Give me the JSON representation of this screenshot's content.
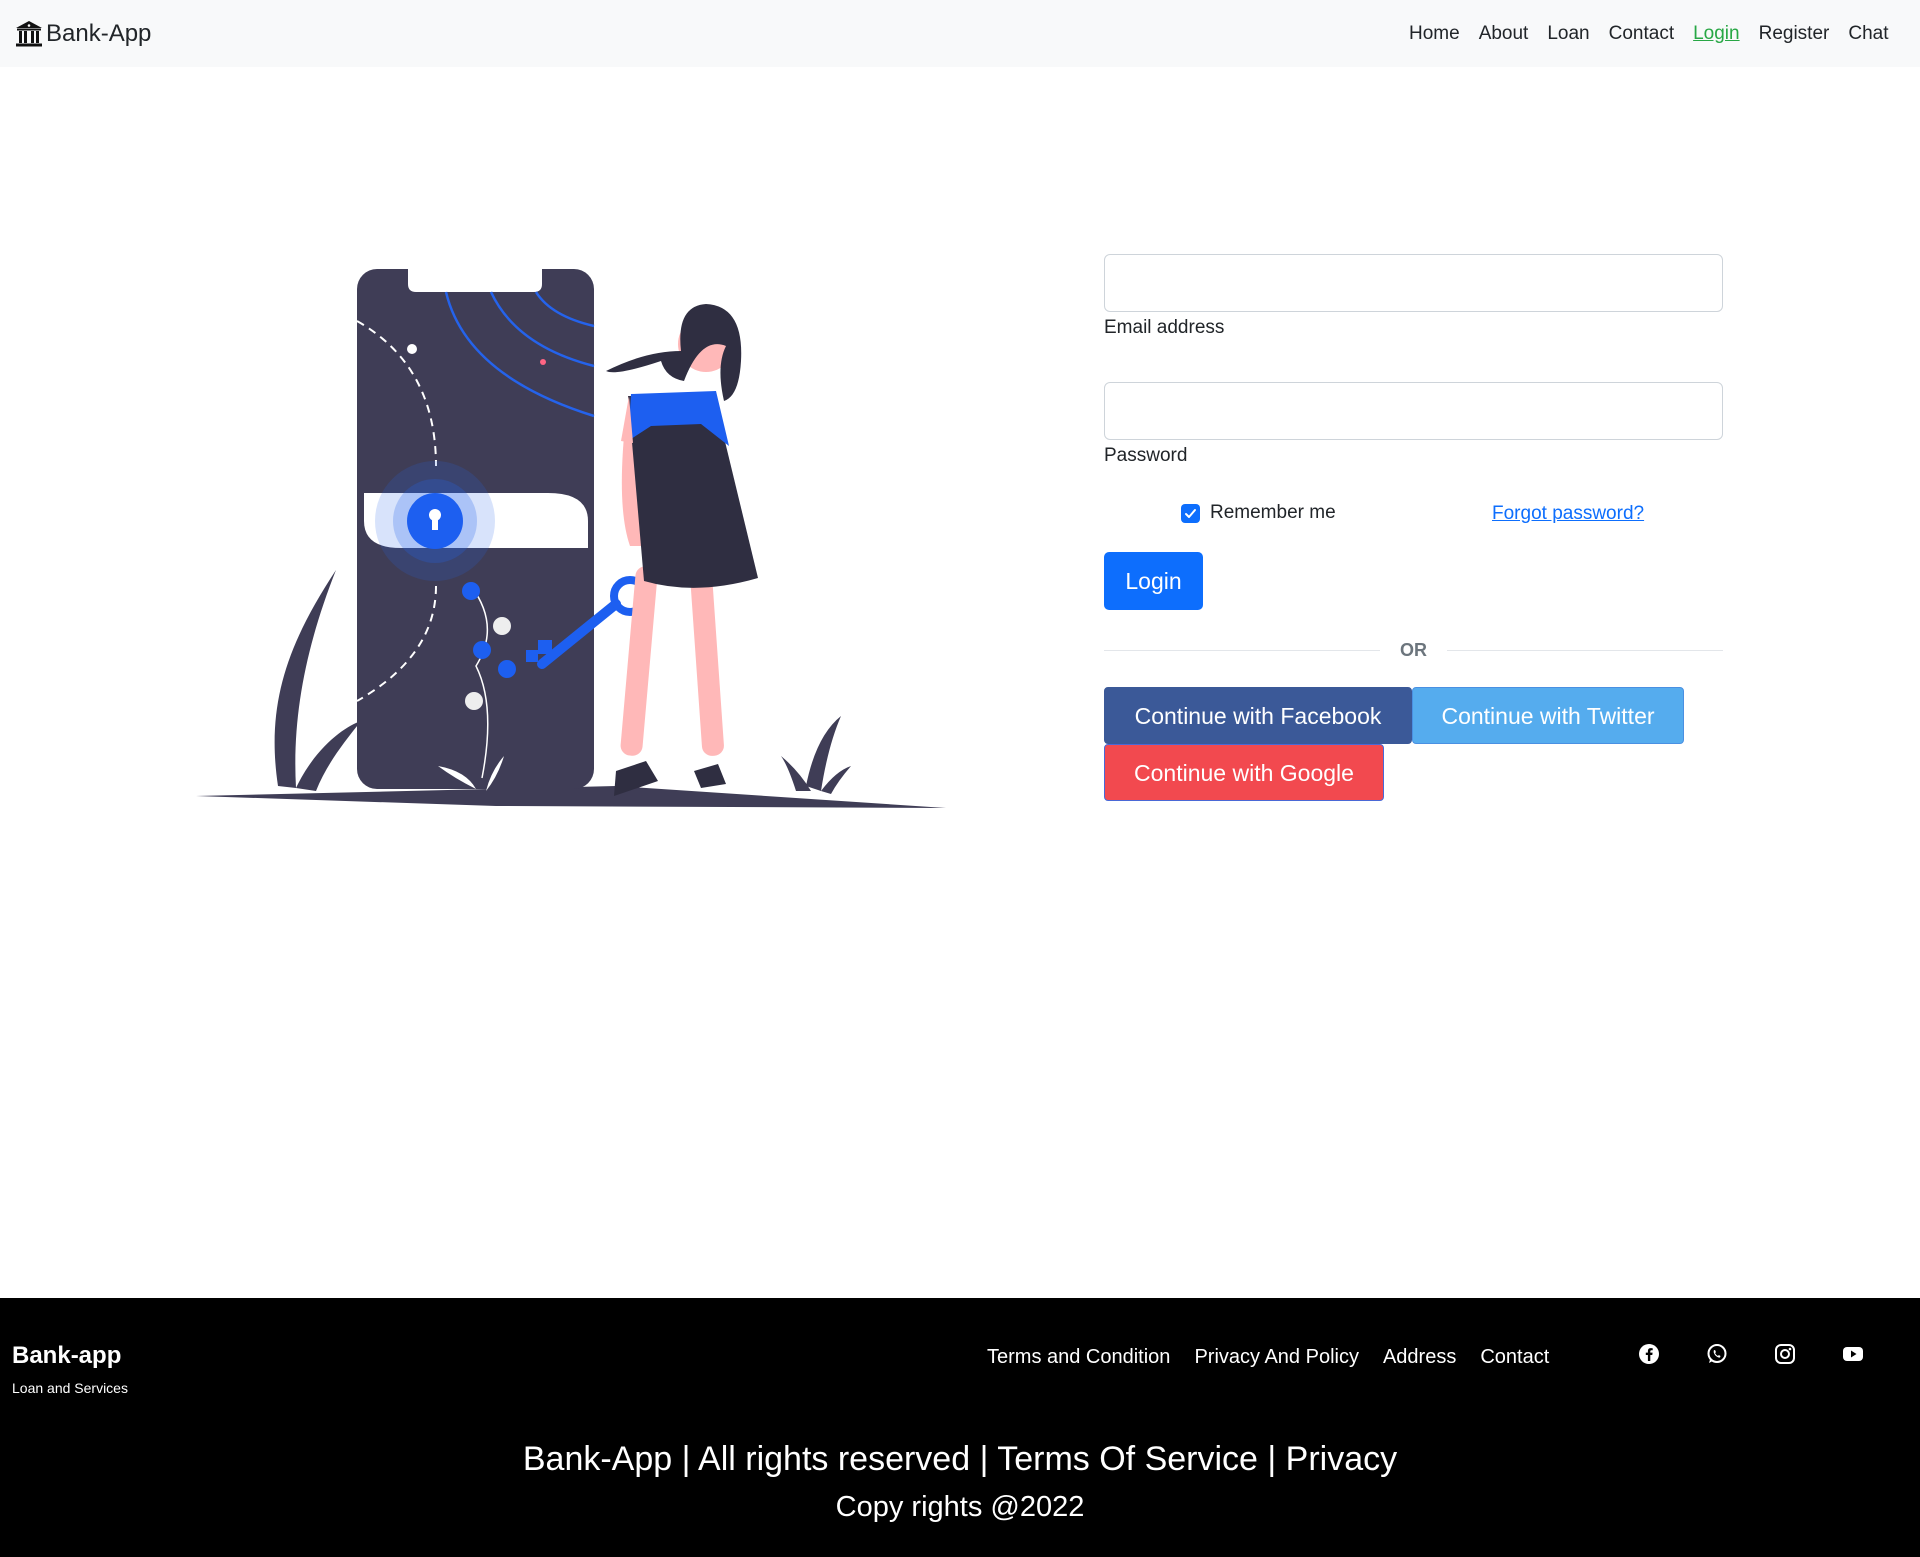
{
  "navbar": {
    "brand": "Bank-App",
    "brand_icon": "bank-building-icon",
    "links": [
      {
        "label": "Home"
      },
      {
        "label": "About"
      },
      {
        "label": "Loan"
      },
      {
        "label": "Contact"
      },
      {
        "label": "Login",
        "active": true
      },
      {
        "label": "Register"
      },
      {
        "label": "Chat"
      }
    ],
    "active_color": "#28a745"
  },
  "illustration": {
    "icon": "security-lock-key-illustration"
  },
  "login_form": {
    "email": {
      "label": "Email address",
      "value": ""
    },
    "password": {
      "label": "Password",
      "value": ""
    },
    "remember": {
      "label": "Remember me",
      "checked": true
    },
    "forgot_password": "Forgot password?",
    "login_button": "Login",
    "divider": "OR",
    "social": {
      "facebook": "Continue with Facebook",
      "twitter": "Continue with Twitter",
      "google": "Continue with Google"
    }
  },
  "footer": {
    "brand": "Bank-app",
    "tagline": "Loan and Services",
    "links": [
      {
        "label": "Terms and Condition"
      },
      {
        "label": "Privacy And Policy"
      },
      {
        "label": "Address"
      },
      {
        "label": "Contact"
      }
    ],
    "social_icons": [
      "facebook-icon",
      "whatsapp-icon",
      "instagram-icon",
      "youtube-icon"
    ],
    "bottom_line": "Bank-App | All rights reserved | Terms Of Service | Privacy",
    "copyright": "Copy rights @2022"
  },
  "colors": {
    "primary": "#0d6efd",
    "facebook": "#3b5998",
    "twitter": "#55acee",
    "google": "#f2494f",
    "navbar_bg": "#f8f9fa",
    "footer_bg": "#000000"
  }
}
